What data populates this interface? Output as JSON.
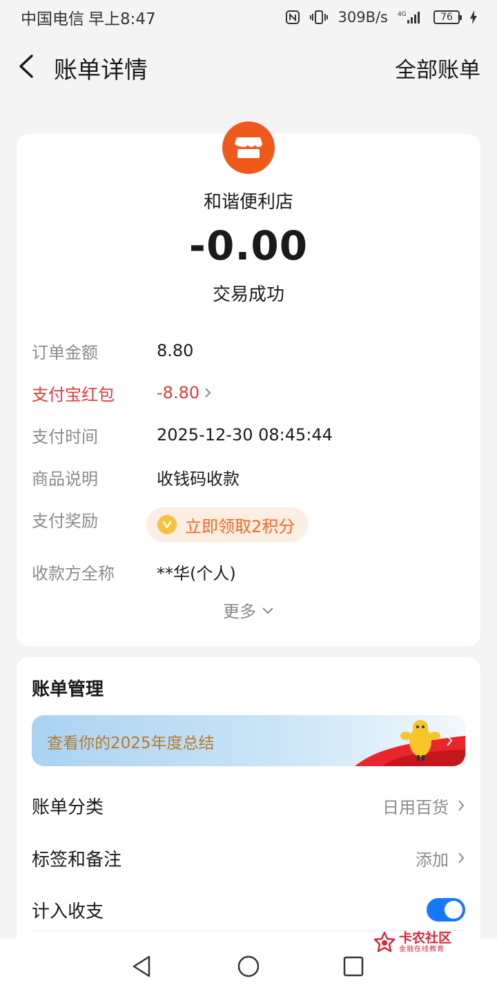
{
  "status_bar": {
    "carrier": "中国电信",
    "time": "早上8:47",
    "network_speed": "309B/s",
    "network_type": "4G",
    "battery": "76"
  },
  "header": {
    "title": "账单详情",
    "all_bills": "全部账单"
  },
  "detail": {
    "merchant_name": "和谐便利店",
    "merchant_icon": "store-icon",
    "amount": "-0.00",
    "status": "交易成功",
    "rows": [
      {
        "label": "订单金额",
        "value": "8.80"
      },
      {
        "label": "支付宝红包",
        "value": "-8.80"
      },
      {
        "label": "支付时间",
        "value": "2025-12-30 08:45:44"
      },
      {
        "label": "商品说明",
        "value": "收钱码收款"
      },
      {
        "label": "支付奖励",
        "value": "立即领取2积分"
      },
      {
        "label": "收款方全称",
        "value": "**华(个人)"
      }
    ],
    "more": "更多"
  },
  "manage": {
    "title": "账单管理",
    "banner_text": "查看你的2025年度总结",
    "category_label": "账单分类",
    "category_value": "日用百货",
    "tags_label": "标签和备注",
    "tags_value": "添加",
    "include_label": "计入收支",
    "include_on": true
  },
  "watermark": {
    "title": "卡农社区",
    "subtitle": "金融在线教育"
  },
  "colors": {
    "accent_orange": "#ef5a1c",
    "red": "#e03a3a",
    "toggle_blue": "#1677ff",
    "reward_text": "#f0691e"
  }
}
